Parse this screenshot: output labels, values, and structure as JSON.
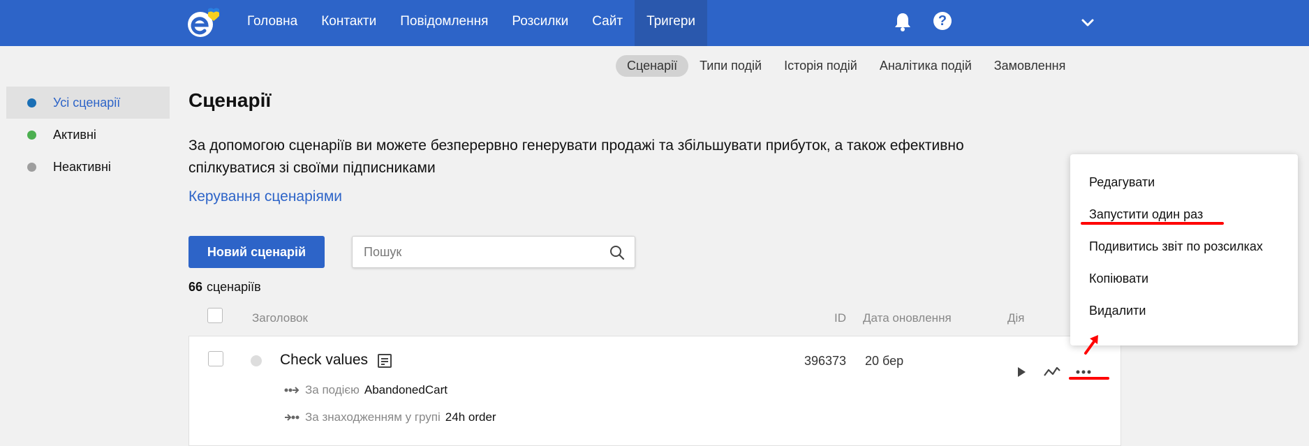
{
  "nav": {
    "items": [
      "Головна",
      "Контакти",
      "Повідомлення",
      "Розсилки",
      "Сайт",
      "Тригери"
    ],
    "active_index": 5
  },
  "subtabs": {
    "items": [
      "Сценарії",
      "Типи подій",
      "Історія подій",
      "Аналітика подій",
      "Замовлення"
    ],
    "active_index": 0
  },
  "sidebar": {
    "items": [
      {
        "label": "Усі сценарії",
        "color": "#1a6fb5"
      },
      {
        "label": "Активні",
        "color": "#4caf50"
      },
      {
        "label": "Неактивні",
        "color": "#9e9e9e"
      }
    ],
    "active_index": 0
  },
  "main": {
    "title": "Сценарії",
    "description": "За допомогою сценаріїв ви можете безперервно генерувати продажі та збільшувати прибуток, а також ефективно спілкуватися зі своїми підписниками",
    "manage_link": "Керування сценаріями",
    "new_button": "Новий сценарій",
    "search_placeholder": "Пошук",
    "count_number": "66",
    "count_label": "сценаріїв"
  },
  "table": {
    "headers": {
      "title": "Заголовок",
      "id": "ID",
      "date": "Дата оновлення",
      "action": "Дія"
    },
    "rows": [
      {
        "title": "Check values",
        "id": "396373",
        "date": "20 бер",
        "conditions": [
          {
            "label": "За подією",
            "value": "AbandonedCart"
          },
          {
            "label": "За знаходженням у групі",
            "value": "24h order"
          }
        ]
      }
    ]
  },
  "menu": {
    "items": [
      "Редагувати",
      "Запустити один раз",
      "Подивитись звіт по розсилках",
      "Копіювати",
      "Видалити"
    ]
  },
  "colors": {
    "brand": "#2d64c8",
    "annotation": "#ff0000"
  }
}
